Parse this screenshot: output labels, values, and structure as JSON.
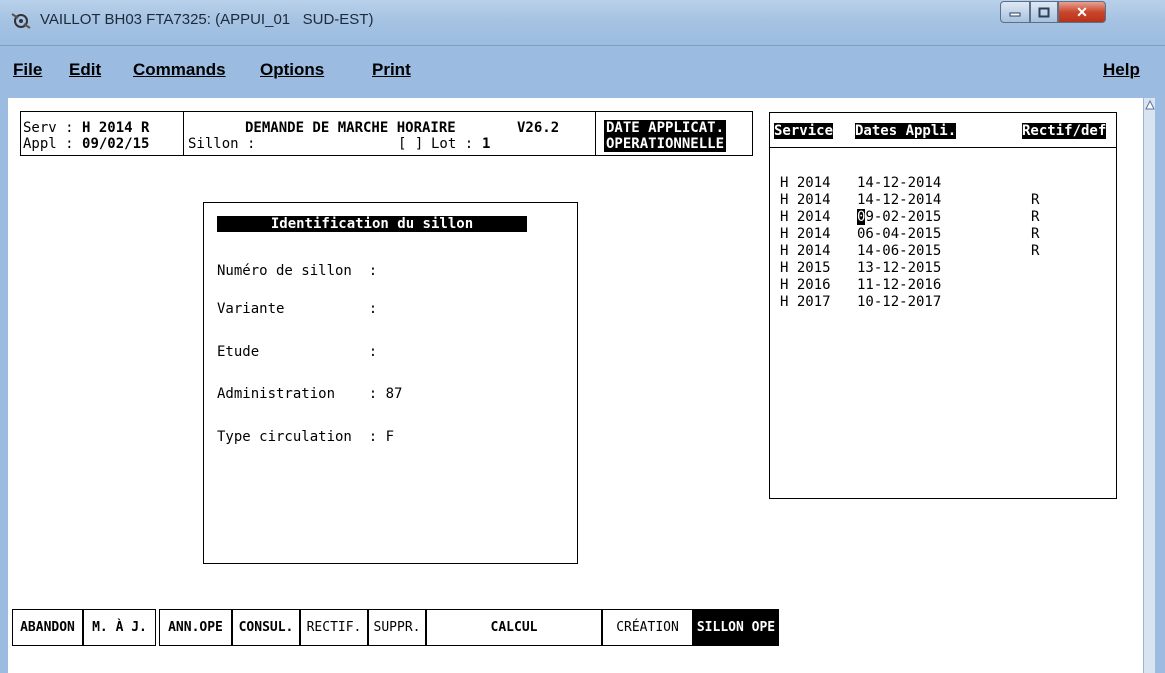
{
  "window": {
    "title": "VAILLOT BH03 FTA7325: (APPUI_01   SUD-EST)"
  },
  "menu": {
    "file": {
      "u": "F",
      "rest": "ile"
    },
    "edit": {
      "u": "E",
      "rest": "dit"
    },
    "commands": {
      "u": "C",
      "rest": "ommands"
    },
    "options": {
      "u": "O",
      "rest": "ptions"
    },
    "print": {
      "u": "P",
      "rest": "rint"
    },
    "help": {
      "u": "H",
      "rest": "elp"
    }
  },
  "header": {
    "serv_label": "Serv : ",
    "serv_value": "H 2014 R",
    "appl_label": "Appl : ",
    "appl_value": "09/02/15",
    "title": "DEMANDE DE MARCHE HORAIRE",
    "version": "V26.2",
    "sillon_label": "Sillon :",
    "sillon_bracket": "[ ]",
    "lot_label": "Lot :",
    "lot_value": "1",
    "date_applicat_1": "DATE APPLICAT.",
    "date_applicat_2": "OPERATIONNELLE"
  },
  "ident": {
    "title": "Identification du sillon",
    "fields": [
      {
        "label": "Numéro de sillon  :",
        "value": ""
      },
      {
        "label": "Variante          :",
        "value": ""
      },
      {
        "label": "Etude             :",
        "value": ""
      },
      {
        "label": "Administration    :",
        "value": "87"
      },
      {
        "label": "Type circulation  :",
        "value": "F"
      }
    ]
  },
  "service_table": {
    "headers": [
      "Service",
      "Dates Appli.",
      "Rectif/def"
    ],
    "rows": [
      {
        "service": "H 2014",
        "date": "14-12-2014",
        "rectif": ""
      },
      {
        "service": "H 2014",
        "date": "14-12-2014",
        "rectif": "R"
      },
      {
        "service": "H 2014",
        "date_cursor": "0",
        "date": "9-02-2015",
        "rectif": "R"
      },
      {
        "service": "H 2014",
        "date": "06-04-2015",
        "rectif": "R"
      },
      {
        "service": "H 2014",
        "date": "14-06-2015",
        "rectif": "R"
      },
      {
        "service": "H 2015",
        "date": "13-12-2015",
        "rectif": ""
      },
      {
        "service": "H 2016",
        "date": "11-12-2016",
        "rectif": ""
      },
      {
        "service": "H 2017",
        "date": "10-12-2017",
        "rectif": ""
      }
    ]
  },
  "function_keys": [
    {
      "label": "ABANDON",
      "style": "bold"
    },
    {
      "label": "M. À J.",
      "style": "bold"
    },
    {
      "label": "ANN.OPE",
      "style": "bold"
    },
    {
      "label": "CONSUL.",
      "style": "bold"
    },
    {
      "label": "RECTIF.",
      "style": "normal"
    },
    {
      "label": "SUPPR.",
      "style": "normal"
    },
    {
      "label": "CALCUL",
      "style": "bold"
    },
    {
      "label": "CRÉATION",
      "style": "normal"
    },
    {
      "label": "SILLON OPE",
      "style": "active"
    }
  ]
}
